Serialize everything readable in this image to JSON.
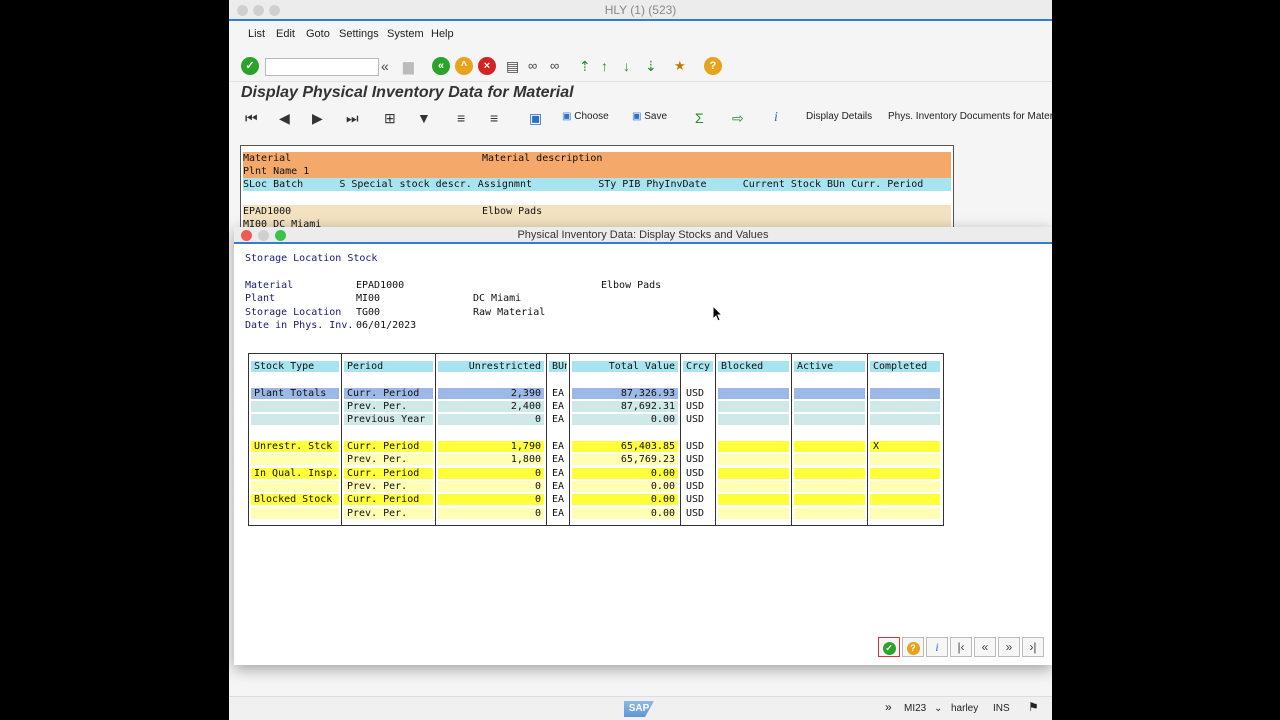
{
  "main_window": {
    "title": "HLY (1) (523)",
    "menu": [
      "List",
      "Edit",
      "Goto",
      "Settings",
      "System",
      "Help"
    ],
    "page_title": "Display Physical Inventory Data for Material",
    "app_toolbar": {
      "choose": "Choose",
      "save": "Save",
      "display_details": "Display Details",
      "phys_docs": "Phys. Inventory Documents for Mater"
    },
    "list_header": {
      "row1_a": "Material",
      "row1_b": "Material description",
      "row2": "Plnt Name 1",
      "row3": "SLoc Batch      S Special stock descr. Assignmnt           STy PIB PhyInvDate      Current Stock BUn Curr. Period"
    },
    "list_row": {
      "material": "EPAD1000",
      "description": "Elbow Pads",
      "plant_line": "MI00 DC Miami"
    }
  },
  "dialog": {
    "title": "Physical Inventory Data: Display Stocks and Values",
    "section_title": "Storage Location Stock",
    "fields": {
      "material_label": "Material",
      "material_value": "EPAD1000",
      "material_desc": "Elbow Pads",
      "plant_label": "Plant",
      "plant_value": "MI00",
      "plant_desc": "DC Miami",
      "sloc_label": "Storage Location",
      "sloc_value": "TG00",
      "sloc_desc": "Raw Material",
      "date_label": "Date in Phys. Inv.",
      "date_value": "06/01/2023"
    },
    "table": {
      "columns": [
        "Stock Type",
        "Period",
        "Unrestricted",
        "BUn",
        "Total Value",
        "Crcy",
        "Blocked",
        "Active",
        "Completed"
      ],
      "rows": [
        {
          "stock_type": "Plant Totals",
          "period": "Curr. Period",
          "unrestricted": "2,390",
          "bun": "EA",
          "total_value": "87,326.93",
          "crcy": "USD",
          "completed": "",
          "style": "selected"
        },
        {
          "stock_type": "",
          "period": "Prev. Per.",
          "unrestricted": "2,400",
          "bun": "EA",
          "total_value": "87,692.31",
          "crcy": "USD",
          "completed": "",
          "style": "teal"
        },
        {
          "stock_type": "",
          "period": "Previous Year",
          "unrestricted": "0",
          "bun": "EA",
          "total_value": "0.00",
          "crcy": "USD",
          "completed": "",
          "style": "teal"
        },
        {
          "stock_type": "Unrestr. Stck",
          "period": "Curr. Period",
          "unrestricted": "1,790",
          "bun": "EA",
          "total_value": "65,403.85",
          "crcy": "USD",
          "completed": "X",
          "style": "yellow"
        },
        {
          "stock_type": "",
          "period": "Prev. Per.",
          "unrestricted": "1,800",
          "bun": "EA",
          "total_value": "65,769.23",
          "crcy": "USD",
          "completed": "",
          "style": "lightyellow"
        },
        {
          "stock_type": "In Qual. Insp.",
          "period": "Curr. Period",
          "unrestricted": "0",
          "bun": "EA",
          "total_value": "0.00",
          "crcy": "USD",
          "completed": "",
          "style": "yellow"
        },
        {
          "stock_type": "",
          "period": "Prev. Per.",
          "unrestricted": "0",
          "bun": "EA",
          "total_value": "0.00",
          "crcy": "USD",
          "completed": "",
          "style": "lightyellow"
        },
        {
          "stock_type": "Blocked Stock",
          "period": "Curr. Period",
          "unrestricted": "0",
          "bun": "EA",
          "total_value": "0.00",
          "crcy": "USD",
          "completed": "",
          "style": "yellow"
        },
        {
          "stock_type": "",
          "period": "Prev. Per.",
          "unrestricted": "0",
          "bun": "EA",
          "total_value": "0.00",
          "crcy": "USD",
          "completed": "",
          "style": "lightyellow"
        }
      ]
    }
  },
  "statusbar": {
    "logo": "SAP",
    "transaction": "MI23",
    "user": "harley",
    "mode": "INS"
  },
  "colors": {
    "header_cyan": "#a8e4f0",
    "orange": "#f4a96b",
    "beige": "#f3e2c2",
    "selected_blue": "#9cb9e6",
    "teal": "#cfe8e8",
    "yellow": "#ffff3a",
    "light_yellow": "#ffffb4",
    "accent_blue": "#2d7fd3"
  }
}
